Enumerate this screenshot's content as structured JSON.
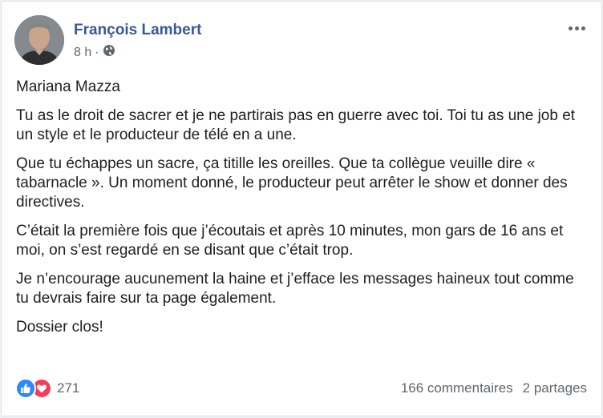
{
  "post": {
    "author": "François Lambert",
    "time": "8 h",
    "separator": "·",
    "privacy_icon": "globe-icon",
    "more_icon": "more-horizontal-icon",
    "paragraphs": [
      "Mariana Mazza",
      "Tu as le droit de sacrer et je ne partirais pas en guerre avec toi. Toi tu as une job et un style et le producteur de télé en a une.",
      "Que tu échappes un sacre, ça titille les oreilles. Que ta collègue veuille dire « tabarnacle ». Un moment donné, le producteur peut arrêter le show et donner des directives.",
      "C’était la première fois que j’écoutais et après 10 minutes, mon gars de 16 ans et moi, on s’est regardé en se disant que c’était trop.",
      "Je n’encourage aucunement la haine et j’efface les messages haineux tout comme tu devrais faire sur ta page également.",
      "Dossier clos!"
    ]
  },
  "footer": {
    "reaction_icons": [
      "like-icon",
      "love-icon"
    ],
    "reaction_count": "271",
    "comments": "166 commentaires",
    "shares": "2 partages"
  },
  "colors": {
    "author_link": "#385898",
    "like": "#2d88ff",
    "love": "#f33e58",
    "secondary_text": "#606770"
  }
}
